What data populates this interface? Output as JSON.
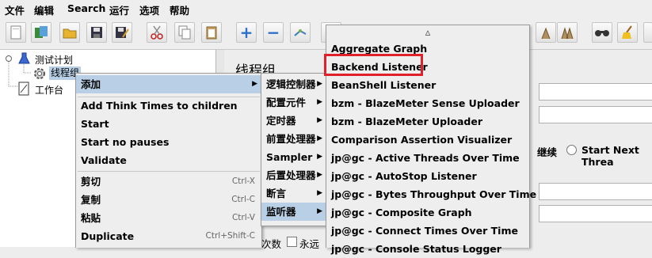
{
  "menubar": [
    "文件",
    "编辑",
    "Search",
    "运行",
    "选项",
    "帮助"
  ],
  "toolbar": {
    "icons": [
      "new-icon",
      "templates-icon",
      "open-icon",
      "save-icon",
      "save-as-icon",
      "cut-icon",
      "copy-icon",
      "paste-icon",
      "expand-icon",
      "collapse-icon",
      "toggle-icon",
      "stop-icon",
      "clear-icon",
      "clear-all-icon",
      "search-icon",
      "broom-icon"
    ]
  },
  "tree": {
    "test_plan": "测试计划",
    "thread_group": "线程组",
    "workbench": "工作台"
  },
  "right_pane": {
    "title": "线程组",
    "continue_text": "继续",
    "start_next_thread": "Start Next Threa",
    "loop_count_partial": "次数",
    "forever": "永远"
  },
  "context_menu": {
    "items": [
      {
        "label": "添加",
        "submenu": true,
        "selected": true
      },
      {
        "separator": true
      },
      {
        "label": "Add Think Times to children"
      },
      {
        "label": "Start"
      },
      {
        "label": "Start no pauses"
      },
      {
        "label": "Validate"
      },
      {
        "separator": true
      },
      {
        "label": "剪切",
        "shortcut": "Ctrl-X"
      },
      {
        "label": "复制",
        "shortcut": "Ctrl-C"
      },
      {
        "label": "粘贴",
        "shortcut": "Ctrl-V"
      },
      {
        "label": "Duplicate",
        "shortcut": "Ctrl+Shift-C"
      }
    ]
  },
  "add_submenu": {
    "items": [
      {
        "label": "逻辑控制器"
      },
      {
        "label": "配置元件"
      },
      {
        "label": "定时器"
      },
      {
        "label": "前置处理器"
      },
      {
        "label": "Sampler"
      },
      {
        "label": "后置处理器"
      },
      {
        "label": "断言"
      },
      {
        "label": "监听器",
        "selected": true
      }
    ]
  },
  "listener_submenu": {
    "scroll_up": "▵",
    "items": [
      {
        "label": "Aggregate Graph"
      },
      {
        "label": "Backend Listener",
        "highlighted": true
      },
      {
        "label": "BeanShell Listener"
      },
      {
        "label": "bzm - BlazeMeter Sense Uploader"
      },
      {
        "label": "bzm - BlazeMeter Uploader"
      },
      {
        "label": "Comparison Assertion Visualizer"
      },
      {
        "label": "jp@gc - Active Threads Over Time"
      },
      {
        "label": "jp@gc - AutoStop Listener"
      },
      {
        "label": "jp@gc - Bytes Throughput Over Time"
      },
      {
        "label": "jp@gc - Composite Graph"
      },
      {
        "label": "jp@gc - Connect Times Over Time"
      },
      {
        "label": "jp@gc - Console Status Logger"
      }
    ]
  },
  "colors": {
    "selection": "#b8cfe5",
    "highlight_box": "#e0202a"
  }
}
